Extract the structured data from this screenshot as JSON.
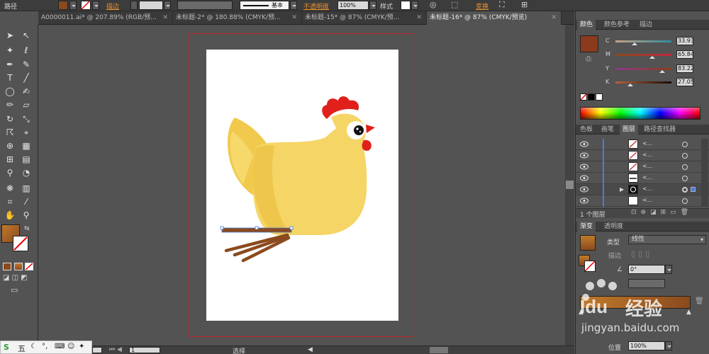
{
  "control_bar": {
    "object_type": "路径",
    "stroke_label": "描边",
    "stroke_width": "",
    "brush_name": "基本",
    "opacity_label": "不透明度",
    "opacity_value": "100%",
    "style_label": "样式",
    "transform_label": "变换",
    "fill_color": "#8b4a1e"
  },
  "tabs": [
    {
      "label": "A0000011.ai* @ 207.89% (RGB/预..."
    },
    {
      "label": "未标题-2* @ 180.88% (CMYK/预..."
    },
    {
      "label": "未标题-15* @ 87% (CMYK/预..."
    },
    {
      "label": "未标题-16* @ 87% (CMYK/预览)"
    }
  ],
  "color_panel": {
    "tabs": [
      "颜色",
      "颜色参考",
      "描边"
    ],
    "current_color": "#8b3b1c",
    "channels": [
      {
        "label": "C",
        "value": "33.93",
        "fraction": 0.34,
        "gradient": "linear-gradient(to right,#c9a089,#2e8d9b)"
      },
      {
        "label": "M",
        "value": "65.84",
        "fraction": 0.66,
        "gradient": "linear-gradient(to right,#8b4a1e,#c0283f)"
      },
      {
        "label": "Y",
        "value": "83.22",
        "fraction": 0.83,
        "gradient": "linear-gradient(to right,#8a3a8a,#8d3c1a)"
      },
      {
        "label": "K",
        "value": "27.05",
        "fraction": 0.27,
        "gradient": "linear-gradient(to right,#b6623a,#1a0a04)"
      }
    ]
  },
  "layers_panel": {
    "tabs": [
      "色板",
      "画笔",
      "图层",
      "路径查找器"
    ],
    "rows": [
      {
        "name": "<...",
        "selected": false
      },
      {
        "name": "<...",
        "selected": false
      },
      {
        "name": "<...",
        "selected": false
      },
      {
        "name": "<...",
        "selected": false
      },
      {
        "name": "<...",
        "selected": true
      },
      {
        "name": "<...",
        "selected": false
      }
    ],
    "count_label": "1 个图层"
  },
  "gradient_panel": {
    "tabs": [
      "渐变",
      "透明度"
    ],
    "type_label": "类型",
    "type_value": "线性",
    "stroke_label": "描边",
    "angle_value": "0°",
    "position_label": "位置",
    "position_value": "100%"
  },
  "status_bar": {
    "zoom_value": "1",
    "mode_label": "选择"
  },
  "taskbar": {
    "ime": "五"
  },
  "watermark": {
    "text": "经验",
    "url": "jingyan.baidu.com"
  },
  "colors": {
    "chicken_body": "#f5d565",
    "chicken_shadow": "#eec64b",
    "comb": "#e0201b",
    "leg": "#8b4a1e",
    "artboard_border": "#c1272d"
  }
}
